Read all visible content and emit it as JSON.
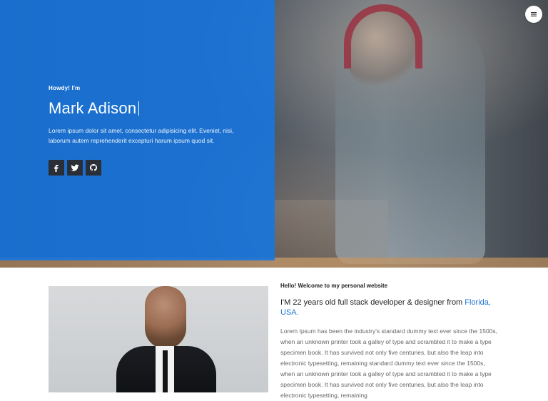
{
  "hero": {
    "greeting": "Howdy! I'm",
    "name": "Mark Adison",
    "intro": "Lorem ipsum dolor sit amet, consectetur adipisicing elit. Eveniet, nisi, laborum autem reprehenderit excepturi harum ipsum quod sit.",
    "social": [
      {
        "icon": "facebook-icon"
      },
      {
        "icon": "twitter-icon"
      },
      {
        "icon": "github-icon"
      }
    ],
    "menu_icon": "menu-icon",
    "accent": "#1876de"
  },
  "about": {
    "welcome": "Hello! Welcome to my personal website",
    "headline_prefix": "I'M 22 years old full stack developer & designer from",
    "location": "Florida, USA.",
    "body": "Lorem Ipsum has been the industry's standard dummy text ever since the 1500s, when an unknown printer took a galley of type and scrambled it to make a type specimen book. It has survived not only five centuries, but also the leap into electronic typesetting, remaining standard dummy text ever since the 1500s, when an unknown printer took a galley of type and scrambled it to make a type specimen book. It has survived not only five centuries, but also the leap into electronic typesetting, remaining",
    "link_color": "#1e73d8"
  }
}
